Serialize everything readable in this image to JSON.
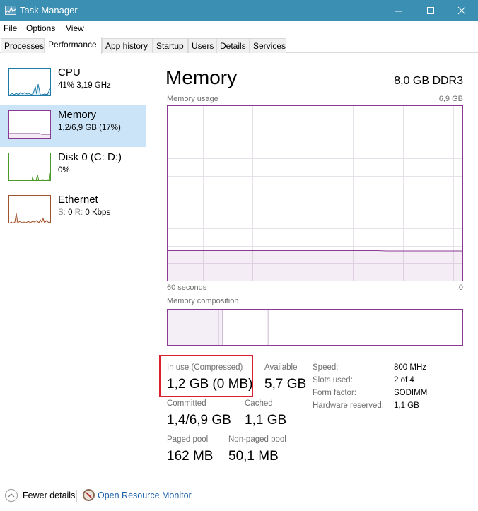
{
  "window": {
    "title": "Task Manager",
    "controls": {
      "minimize": "—",
      "maximize": "☐",
      "close": "✕"
    }
  },
  "menu": [
    "File",
    "Options",
    "View"
  ],
  "tabs": [
    {
      "label": "Processes",
      "active": false
    },
    {
      "label": "Performance",
      "active": true
    },
    {
      "label": "App history",
      "active": false
    },
    {
      "label": "Startup",
      "active": false
    },
    {
      "label": "Users",
      "active": false
    },
    {
      "label": "Details",
      "active": false
    },
    {
      "label": "Services",
      "active": false
    }
  ],
  "sidebar": {
    "items": [
      {
        "name": "CPU",
        "sub": "41%  3,19 GHz",
        "color": "#1f7aa8",
        "selected": false
      },
      {
        "name": "Memory",
        "sub": "1,2/6,9 GB (17%)",
        "color": "#8b3a93",
        "selected": true
      },
      {
        "name": "Disk 0 (C: D:)",
        "sub": "0%",
        "color": "#4d9a2a",
        "selected": false
      },
      {
        "name": "Ethernet",
        "sub_s_label": "S:",
        "sub_s_value": "0",
        "sub_r_label": "R:",
        "sub_r_value": "0 Kbps",
        "color": "#a0522d",
        "selected": false
      }
    ]
  },
  "main": {
    "title": "Memory",
    "spec": "8,0 GB DDR3",
    "usage_label": "Memory usage",
    "usage_max": "6,9 GB",
    "time_left": "60 seconds",
    "time_right": "0",
    "composition_label": "Memory composition",
    "accent_color": "#8b3a93",
    "stats": {
      "in_use_label": "In use (Compressed)",
      "in_use_value": "1,2 GB (0 MB)",
      "available_label": "Available",
      "available_value": "5,7 GB",
      "committed_label": "Committed",
      "committed_value": "1,4/6,9 GB",
      "cached_label": "Cached",
      "cached_value": "1,1 GB",
      "paged_label": "Paged pool",
      "paged_value": "162 MB",
      "nonpaged_label": "Non-paged pool",
      "nonpaged_value": "50,1 MB"
    },
    "details": [
      {
        "label": "Speed:",
        "value": "800 MHz"
      },
      {
        "label": "Slots used:",
        "value": "2 of 4"
      },
      {
        "label": "Form factor:",
        "value": "SODIMM"
      },
      {
        "label": "Hardware reserved:",
        "value": "1,1 GB"
      }
    ],
    "usage_fraction": 0.17,
    "composition": {
      "in_use_fraction": 0.174,
      "modified_fraction": 0.012,
      "standby_fraction": 0.155
    }
  },
  "footer": {
    "fewer_details": "Fewer details",
    "open_resource_monitor": "Open Resource Monitor"
  }
}
